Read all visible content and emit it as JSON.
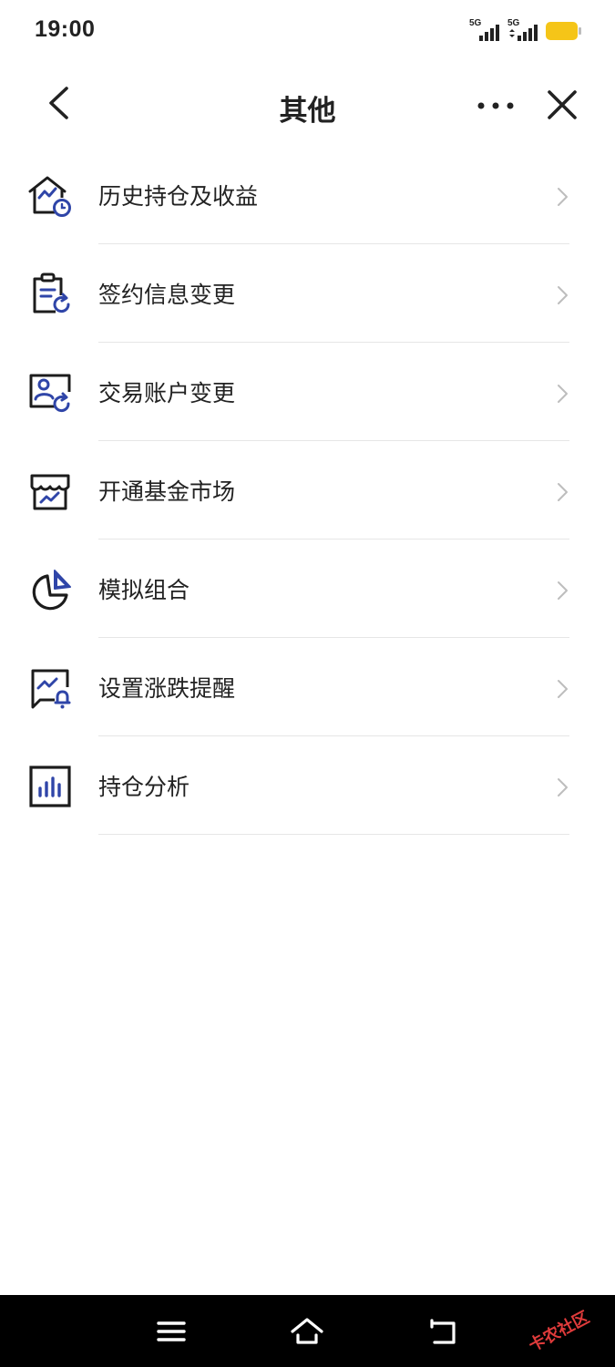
{
  "status_bar": {
    "time": "19:00",
    "sim1_label": "5G",
    "sim2_label": "5G",
    "battery_color": "#f5c518"
  },
  "header": {
    "title": "其他",
    "back_icon": "chevron-left-icon",
    "more_icon": "more-horizontal-icon",
    "close_icon": "close-icon"
  },
  "menu": {
    "items": [
      {
        "label": "历史持仓及收益",
        "icon": "house-chart-clock-icon"
      },
      {
        "label": "签约信息变更",
        "icon": "clipboard-refresh-icon"
      },
      {
        "label": "交易账户变更",
        "icon": "account-refresh-icon"
      },
      {
        "label": "开通基金市场",
        "icon": "storefront-chart-icon"
      },
      {
        "label": "模拟组合",
        "icon": "pie-chart-icon"
      },
      {
        "label": "设置涨跌提醒",
        "icon": "chat-chart-bell-icon"
      },
      {
        "label": "持仓分析",
        "icon": "bar-chart-icon"
      }
    ]
  },
  "nav_bar": {
    "menu_icon": "menu-icon",
    "home_icon": "home-icon",
    "back_icon": "back-icon",
    "watermark": "卡农社区"
  },
  "colors": {
    "accent_blue": "#2f45a8",
    "icon_dark": "#1c1c1c",
    "divider": "#e6e6e6"
  }
}
